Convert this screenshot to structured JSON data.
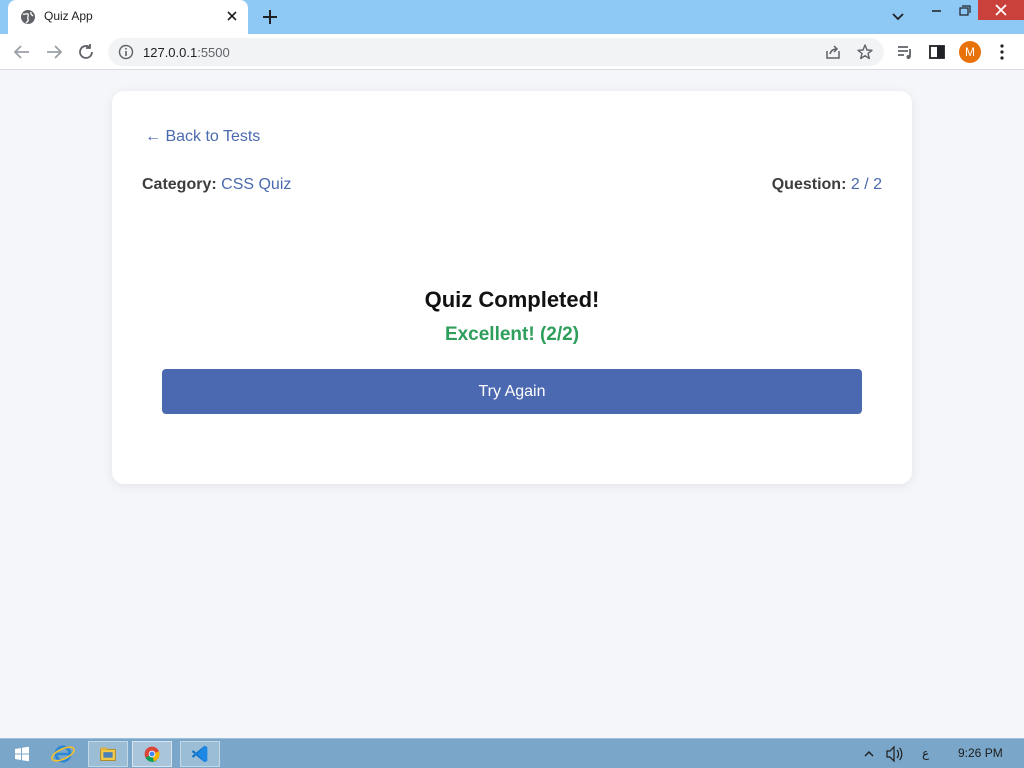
{
  "browser": {
    "tab_title": "Quiz App",
    "url_host": "127.0.0.1",
    "url_port": ":5500",
    "avatar_letter": "M"
  },
  "page": {
    "back_link": "← Back to Tests",
    "category_label": "Category:",
    "category_value": "CSS Quiz",
    "question_label": "Question:",
    "question_value": "2 / 2",
    "result_title": "Quiz Completed!",
    "result_score": "Excellent! (2/2)",
    "try_again_label": "Try Again"
  },
  "taskbar": {
    "language": "ع",
    "time": "9:26 PM"
  },
  "colors": {
    "link": "#4a6aaf",
    "score_green": "#2e9e5b",
    "button": "#4b69b0",
    "avatar": "#e8710a"
  }
}
